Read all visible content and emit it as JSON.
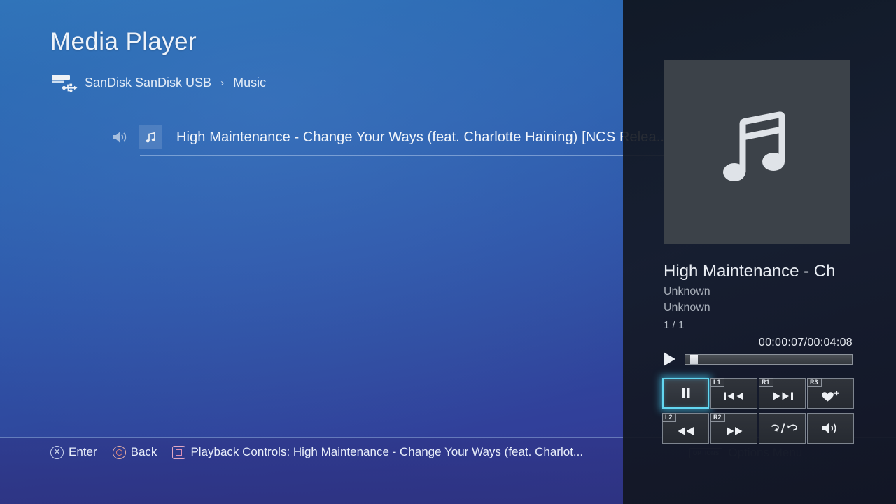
{
  "header": {
    "title": "Media Player",
    "breadcrumb": {
      "device_icon": "usb-drive-icon",
      "device": "SanDisk SanDisk USB",
      "separator": "›",
      "folder": "Music"
    }
  },
  "list": {
    "items": [
      {
        "speaker_icon": "speaker-playing-icon",
        "thumb_icon": "music-note-icon",
        "title": "High Maintenance - Change Your Ways (feat. Charlotte Haining) [NCS Relea..."
      }
    ]
  },
  "footer": {
    "hints": [
      {
        "button": "cross",
        "label": "Enter"
      },
      {
        "button": "circle",
        "label": "Back"
      },
      {
        "button": "square",
        "label": "Playback Controls: High Maintenance - Change Your Ways (feat. Charlot..."
      }
    ],
    "options": {
      "chip": "OPTIONS",
      "label": "Options Menu"
    }
  },
  "panel": {
    "art_icon": "music-note-icon",
    "title": "High Maintenance - Ch",
    "artist": "Unknown",
    "album": "Unknown",
    "track_count": "1 / 1",
    "time": "00:00:07/00:04:08",
    "state_icon": "play-icon",
    "progress_percent": 2.8,
    "controls": [
      {
        "name": "pause-button",
        "badge": "",
        "icon": "pause-icon",
        "selected": true
      },
      {
        "name": "previous-button",
        "badge": "L1",
        "icon": "previous-icon",
        "selected": false
      },
      {
        "name": "next-button",
        "badge": "R1",
        "icon": "next-icon",
        "selected": false
      },
      {
        "name": "add-favorite-button",
        "badge": "R3",
        "icon": "heart-plus-icon",
        "selected": false
      },
      {
        "name": "rewind-button",
        "badge": "L2",
        "icon": "rewind-icon",
        "selected": false
      },
      {
        "name": "fast-forward-button",
        "badge": "R2",
        "icon": "fast-forward-icon",
        "selected": false
      },
      {
        "name": "repeat-shuffle-button",
        "badge": "",
        "icon": "repeat-shuffle-icon",
        "selected": false
      },
      {
        "name": "volume-button",
        "badge": "",
        "icon": "volume-icon",
        "selected": false
      }
    ]
  },
  "colors": {
    "background_top": "#2a6fb5",
    "background_bottom": "#343a8f",
    "panel": "#12161f",
    "selection_glow": "#63d6f0",
    "text_primary": "#eef3fa"
  }
}
